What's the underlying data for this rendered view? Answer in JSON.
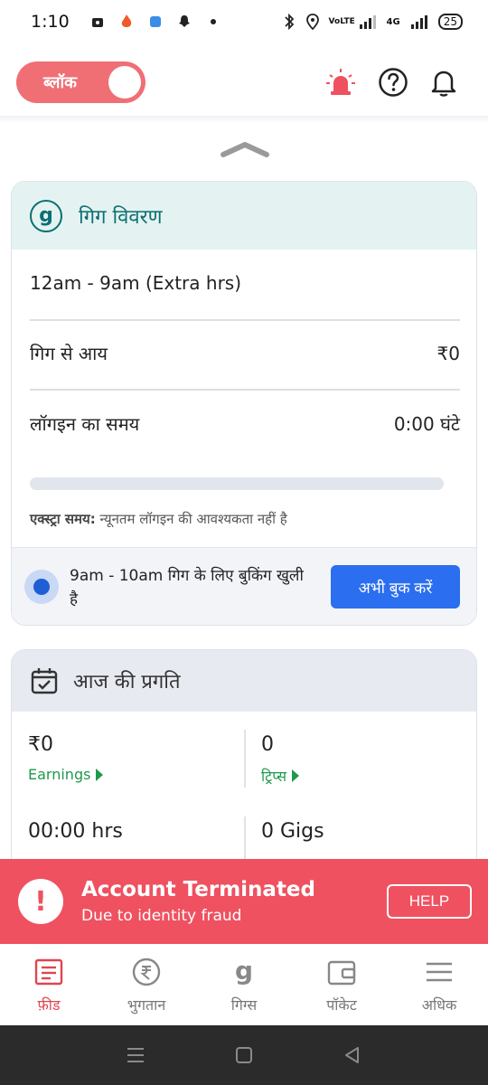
{
  "status_bar": {
    "time": "1:10",
    "network": "VoLTE",
    "signal_type": "4G",
    "battery": "25"
  },
  "header": {
    "block_toggle_label": "ब्लॉक",
    "icons": [
      "alarm-siren-icon",
      "help-question-icon",
      "notification-bell-icon"
    ]
  },
  "gig_card": {
    "title": "गिग विवरण",
    "logo_letter": "g",
    "time_slot": "12am - 9am (Extra hrs)",
    "earnings_label": "गिग से आय",
    "earnings_value": "₹0",
    "login_label": "लॉगइन का समय",
    "login_value": "0:00 घंटे",
    "login_progress": 0,
    "extra_label": "एक्स्ट्रा समय:",
    "extra_note": "न्यूनतम लॉगइन की आवश्यकता नहीं है",
    "booking_text": "9am - 10am गिग के लिए बुकिंग खुली है",
    "book_button": "अभी बुक करें"
  },
  "progress_card": {
    "title": "आज की प्रगति",
    "stats": [
      {
        "value": "₹0",
        "label": "Earnings"
      },
      {
        "value": "0",
        "label": "ट्रिप्स"
      },
      {
        "value": "00:00 hrs",
        "label": ""
      },
      {
        "value": "0 Gigs",
        "label": ""
      }
    ]
  },
  "banner": {
    "title": "Account Terminated",
    "subtitle": "Due to identity fraud",
    "help_button": "HELP",
    "colors": {
      "background": "#ef5160"
    }
  },
  "bottom_nav": {
    "items": [
      {
        "label": "फ़ीड",
        "icon": "feed-icon",
        "active": true
      },
      {
        "label": "भुगतान",
        "icon": "rupee-icon",
        "active": false
      },
      {
        "label": "गिग्स",
        "icon": "gigs-g-icon",
        "active": false
      },
      {
        "label": "पॉकेट",
        "icon": "wallet-icon",
        "active": false
      },
      {
        "label": "अधिक",
        "icon": "menu-icon",
        "active": false
      }
    ]
  },
  "colors": {
    "accent": "#2b6ef0",
    "brand_teal": "#0c6f72",
    "active_nav": "#e04550",
    "positive": "#1f9a4c"
  }
}
